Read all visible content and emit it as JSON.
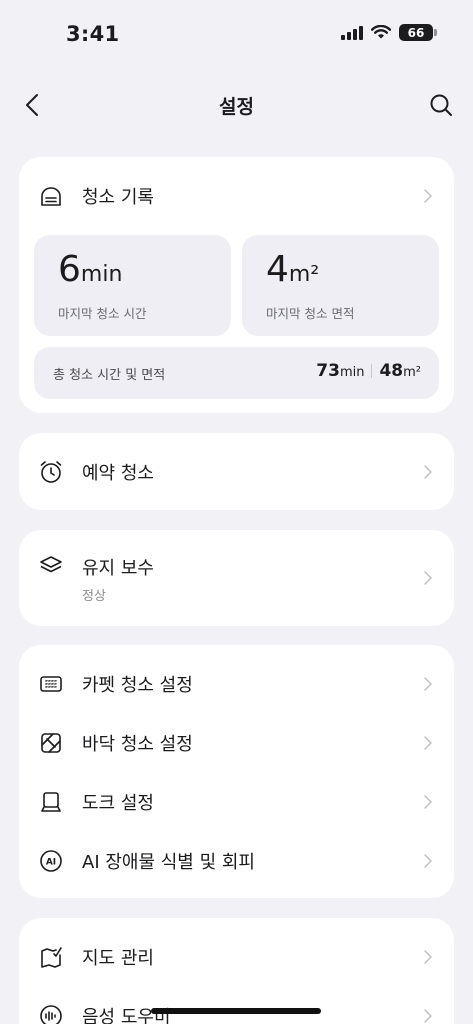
{
  "status_bar": {
    "time": "3:41",
    "battery": "66"
  },
  "nav": {
    "title": "설정"
  },
  "cleaning_record": {
    "title": "청소 기록",
    "last_time": {
      "value": "6",
      "unit": "min",
      "label": "마지막 청소 시간"
    },
    "last_area": {
      "value": "4",
      "unit": "m²",
      "label": "마지막 청소 면적"
    },
    "total": {
      "label": "총 청소 시간 및 면적",
      "time_value": "73",
      "time_unit": "min",
      "area_value": "48",
      "area_unit": "m²"
    }
  },
  "schedule": {
    "label": "예약 청소"
  },
  "maintenance": {
    "label": "유지 보수",
    "status": "정상"
  },
  "settings_group": {
    "carpet": "카펫 청소 설정",
    "floor": "바닥 청소 설정",
    "dock": "도크 설정",
    "ai": "AI 장애물 식별 및 회피"
  },
  "map_group": {
    "map": "지도 관리",
    "voice": "음성 도우미"
  }
}
